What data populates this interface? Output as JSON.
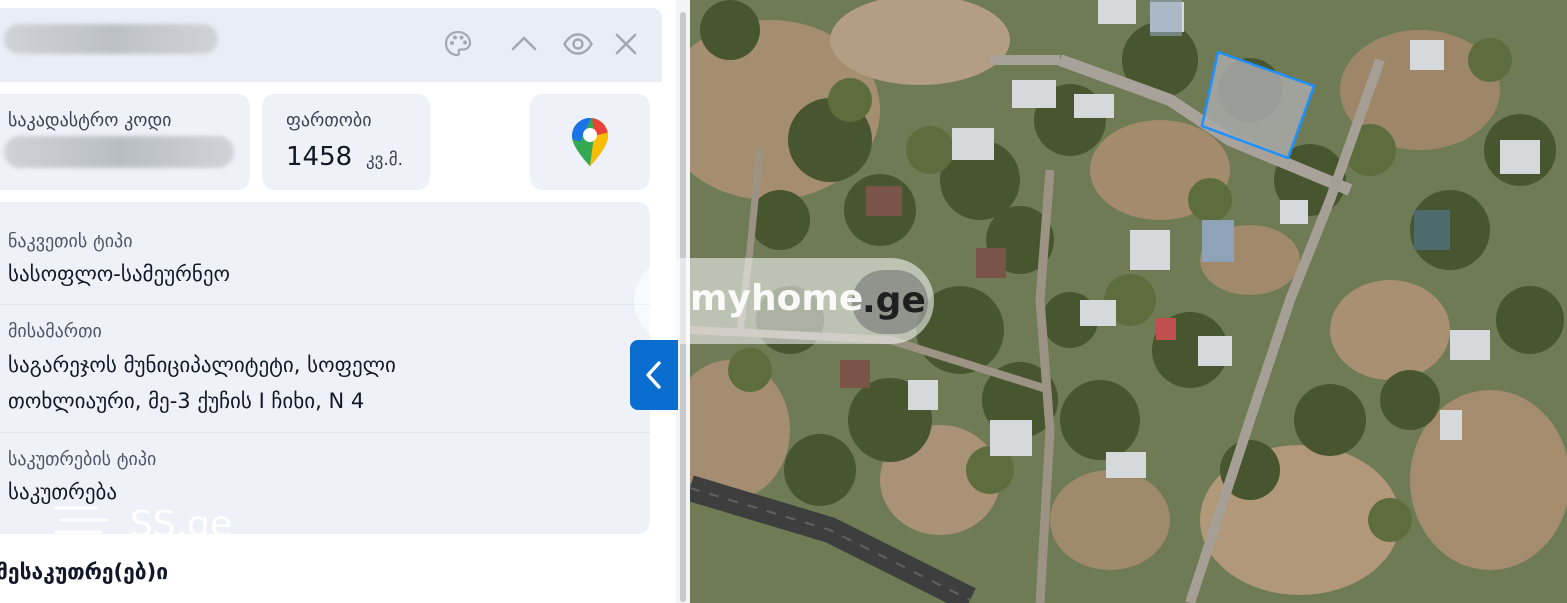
{
  "panel": {
    "header_icons": [
      "palette-icon",
      "chevron-up-icon",
      "eye-icon",
      "close-icon"
    ]
  },
  "cadastral": {
    "label": "საკადასტრო კოდი"
  },
  "area": {
    "label": "ფართობი",
    "value": "1458",
    "unit": "კვ.მ."
  },
  "maps_button": {
    "icon": "google-maps-pin-icon"
  },
  "info": {
    "plot_type_label": "ნაკვეთის ტიპი",
    "plot_type_value": "სასოფლო-სამეურნეო",
    "address_label": "მისამართი",
    "address_line1": "საგარეჯოს მუნიციპალიტეტი, სოფელი",
    "address_line2": "თოხლიაური, მე-3 ქუჩის I ჩიხი, N 4",
    "ownership_label": "საკუთრების ტიპი",
    "ownership_value": "საკუთრება"
  },
  "owners_heading": "მესაკუთრე(ებ)ი",
  "watermarks": {
    "myhome_text": "myhome",
    "myhome_domain": ".ge",
    "ss_text": "SS.ge"
  },
  "colors": {
    "accent": "#0a6ed1",
    "panel_bg": "#eef2f8",
    "header_bg": "#e9eef6",
    "parcel_outline": "#1e90ff"
  }
}
